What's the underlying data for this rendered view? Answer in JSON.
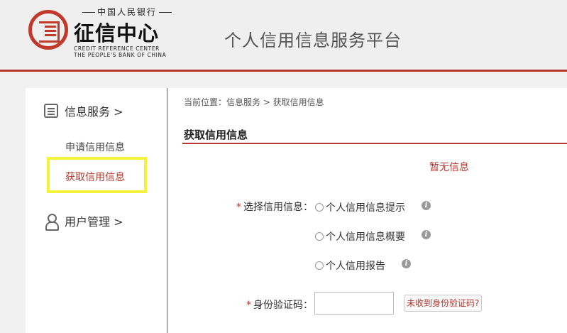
{
  "header": {
    "logo": {
      "top_text": "中国人民银行",
      "name": "征信中心",
      "en_line1": "CREDIT REFERENCE CENTER",
      "en_line2": "THE PEOPLE'S BANK OF CHINA"
    },
    "title": "个人信用信息服务平台"
  },
  "sidebar": {
    "groups": [
      {
        "label": "信息服务 >",
        "icon": "document-icon"
      },
      {
        "label": "用户管理 >",
        "icon": "user-icon"
      }
    ],
    "sub_items": [
      {
        "label": "申请信用信息",
        "active": false
      },
      {
        "label": "获取信用信息",
        "active": true
      }
    ]
  },
  "main": {
    "breadcrumb": "当前位置：信息服务 > 获取信用信息",
    "section_title": "获取信用信息",
    "notice": "暂无信息",
    "select_label": "选择信用信息：",
    "required_mark": "*",
    "options": [
      {
        "label": "个人信用信息提示"
      },
      {
        "label": "个人信用信息概要"
      },
      {
        "label": "个人信用报告"
      }
    ],
    "code_label": "身份验证码：",
    "code_value": "",
    "resend_link": "未收到身份验证码?"
  },
  "colors": {
    "accent": "#b5372f",
    "highlight": "#f3f33a"
  }
}
